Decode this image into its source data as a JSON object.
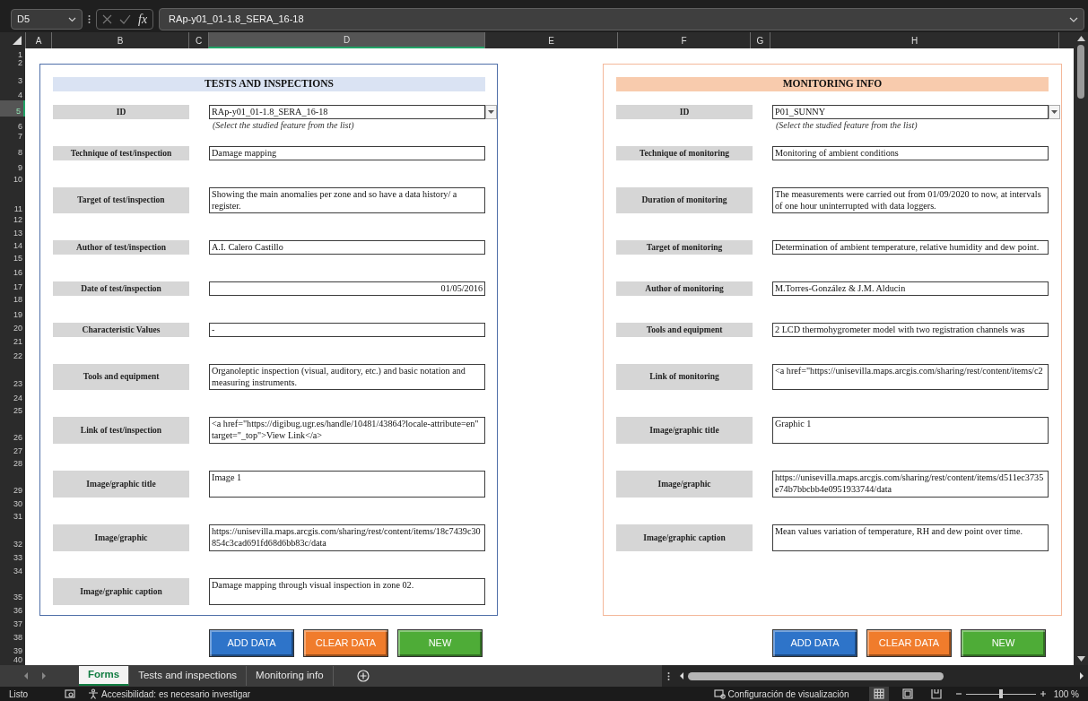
{
  "formula_bar": {
    "name_box": "D5",
    "function_label": "fx",
    "formula": "RAp-y01_01-1.8_SERA_16-18"
  },
  "columns": [
    {
      "label": "A",
      "selected": false
    },
    {
      "label": "B",
      "selected": false
    },
    {
      "label": "C",
      "selected": false
    },
    {
      "label": "D",
      "selected": true
    },
    {
      "label": "E",
      "selected": false
    },
    {
      "label": "F",
      "selected": false
    },
    {
      "label": "G",
      "selected": false
    },
    {
      "label": "H",
      "selected": false
    }
  ],
  "rows": [
    {
      "label": "1",
      "selected": false
    },
    {
      "label": "2",
      "selected": false
    },
    {
      "label": "3",
      "selected": false
    },
    {
      "label": "4",
      "selected": false
    },
    {
      "label": "5",
      "selected": true
    },
    {
      "label": "6",
      "selected": false
    },
    {
      "label": "7",
      "selected": false
    },
    {
      "label": "8",
      "selected": false
    },
    {
      "label": "9",
      "selected": false
    },
    {
      "label": "10",
      "selected": false
    },
    {
      "label": "11",
      "selected": false
    },
    {
      "label": "12",
      "selected": false
    },
    {
      "label": "13",
      "selected": false
    },
    {
      "label": "14",
      "selected": false
    },
    {
      "label": "15",
      "selected": false
    },
    {
      "label": "16",
      "selected": false
    },
    {
      "label": "17",
      "selected": false
    },
    {
      "label": "18",
      "selected": false
    },
    {
      "label": "19",
      "selected": false
    },
    {
      "label": "20",
      "selected": false
    },
    {
      "label": "21",
      "selected": false
    },
    {
      "label": "22",
      "selected": false
    },
    {
      "label": "23",
      "selected": false
    },
    {
      "label": "24",
      "selected": false
    },
    {
      "label": "25",
      "selected": false
    },
    {
      "label": "26",
      "selected": false
    },
    {
      "label": "27",
      "selected": false
    },
    {
      "label": "28",
      "selected": false
    },
    {
      "label": "29",
      "selected": false
    },
    {
      "label": "30",
      "selected": false
    },
    {
      "label": "31",
      "selected": false
    },
    {
      "label": "32",
      "selected": false
    },
    {
      "label": "33",
      "selected": false
    },
    {
      "label": "34",
      "selected": false
    },
    {
      "label": "35",
      "selected": false
    },
    {
      "label": "36",
      "selected": false
    },
    {
      "label": "37",
      "selected": false
    },
    {
      "label": "38",
      "selected": false
    },
    {
      "label": "39",
      "selected": false
    },
    {
      "label": "40",
      "selected": false
    }
  ],
  "forms": [
    {
      "title": "TESTS AND INSPECTIONS",
      "fields": [
        {
          "kind": "dropdown",
          "label": "ID",
          "value": "RAp-y01_01-1.8_SERA_16-18",
          "hint": "(Select the studied feature from the list)"
        },
        {
          "kind": "text",
          "label": "Technique of test/inspection",
          "value": "Damage mapping"
        },
        {
          "kind": "text",
          "label": "Target of test/inspection",
          "value": "Showing the main anomalies per zone and so have a data history/ a register."
        },
        {
          "kind": "text",
          "label": "Author of test/inspection",
          "value": "A.I. Calero Castillo"
        },
        {
          "kind": "date",
          "label": "Date of test/inspection",
          "value": "01/05/2016"
        },
        {
          "kind": "text",
          "label": "Characteristic Values",
          "value": "-"
        },
        {
          "kind": "text",
          "label": "Tools and equipment",
          "value": "Organoleptic inspection (visual, auditory, etc.) and basic notation and measuring instruments."
        },
        {
          "kind": "text",
          "label": "Link of test/inspection",
          "value": "<a href=\"https://digibug.ugr.es/handle/10481/43864?locale-attribute=en\" target=\"_top\">View Link</a>"
        },
        {
          "kind": "text",
          "label": "Image/graphic title",
          "value": "Image 1"
        },
        {
          "kind": "text",
          "label": "Image/graphic",
          "value": "https://unisevilla.maps.arcgis.com/sharing/rest/content/items/18c7439c30854c3cad691fd68d6bb83c/data"
        },
        {
          "kind": "text",
          "label": "Image/graphic caption",
          "value": "Damage mapping through visual inspection in zone 02."
        }
      ],
      "buttons": [
        {
          "kind": "add",
          "label": "ADD DATA"
        },
        {
          "kind": "clear",
          "label": "CLEAR DATA"
        },
        {
          "kind": "new",
          "label": "NEW"
        }
      ]
    },
    {
      "title": "MONITORING INFO",
      "fields": [
        {
          "kind": "dropdown",
          "label": "ID",
          "value": "P01_SUNNY",
          "hint": "(Select the studied feature from the list)"
        },
        {
          "kind": "text",
          "label": "Technique of monitoring",
          "value": "Monitoring of ambient conditions"
        },
        {
          "kind": "text",
          "label": "Duration of monitoring",
          "value": "The measurements were carried out from 01/09/2020 to now, at intervals of one hour uninterrupted with data loggers."
        },
        {
          "kind": "text",
          "label": "Target of monitoring",
          "value": "Determination of ambient temperature, relative humidity and dew point."
        },
        {
          "kind": "text",
          "label": "Author of monitoring",
          "value": "M.Torres-González & J.M. Alducin"
        },
        {
          "kind": "text",
          "label": "Tools and equipment",
          "value": "2 LCD thermohygrometer model with two registration channels was"
        },
        {
          "kind": "text",
          "label": "Link of monitoring",
          "value": "<a href=\"https://unisevilla.maps.arcgis.com/sharing/rest/content/items/c2"
        },
        {
          "kind": "text",
          "label": "Image/graphic title",
          "value": "Graphic 1"
        },
        {
          "kind": "text",
          "label": "Image/graphic",
          "value": "https://unisevilla.maps.arcgis.com/sharing/rest/content/items/d511ec3735e74b7bbcbb4e0951933744/data"
        },
        {
          "kind": "text",
          "label": "Image/graphic caption",
          "value": "Mean values variation of temperature, RH and dew point over time."
        }
      ],
      "buttons": [
        {
          "kind": "add",
          "label": "ADD DATA"
        },
        {
          "kind": "clear",
          "label": "CLEAR DATA"
        },
        {
          "kind": "new",
          "label": "NEW"
        }
      ]
    }
  ],
  "sheet_tabs": [
    {
      "label": "Forms",
      "selected": true
    },
    {
      "label": "Tests and inspections",
      "selected": false
    },
    {
      "label": "Monitoring info",
      "selected": false
    }
  ],
  "status_bar": {
    "ready": "Listo",
    "accessibility": "Accesibilidad: es necesario investigar",
    "display_settings": "Configuración de visualización",
    "views": [
      {
        "kind": "normal",
        "selected": true
      },
      {
        "kind": "page_layout",
        "selected": false
      },
      {
        "kind": "page_break",
        "selected": false
      }
    ],
    "zoom": {
      "level": 0.5,
      "reading": "100 %"
    }
  }
}
